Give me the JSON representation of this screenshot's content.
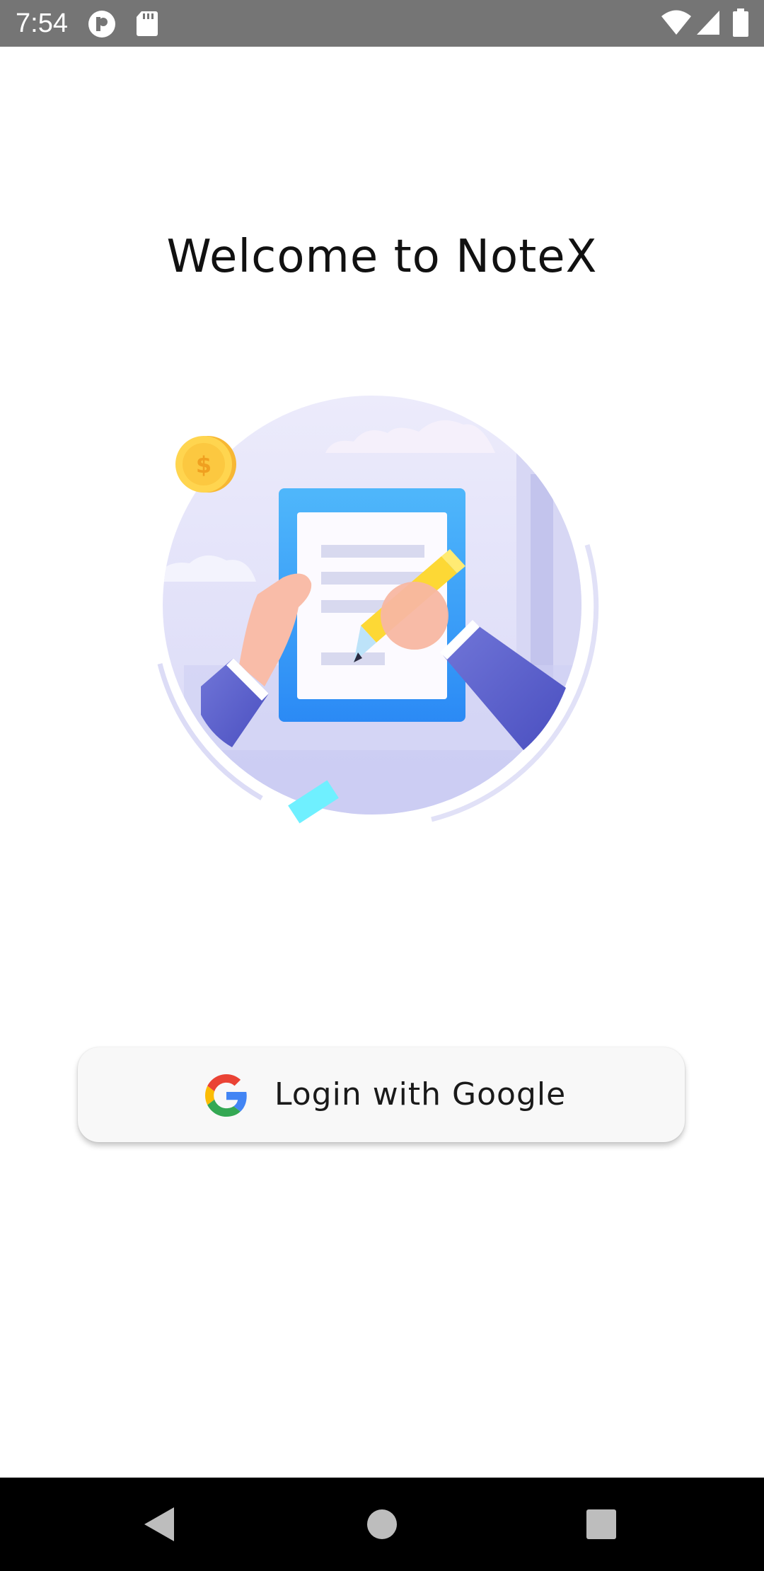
{
  "status_bar": {
    "time": "7:54",
    "background_color": "#757575",
    "icons": [
      "notification-app-icon",
      "sd-card-icon",
      "wifi-icon",
      "signal-icon",
      "battery-icon"
    ]
  },
  "welcome": {
    "title": "Welcome to NoteX"
  },
  "illustration": {
    "description_icon": "note-writing-illustration",
    "coin_symbol": "$"
  },
  "login_button": {
    "label": "Login with Google",
    "icon": "google-icon"
  },
  "nav_bar": {
    "back": "back-icon",
    "home": "home-icon",
    "recents": "recents-icon"
  },
  "colors": {
    "accent_blue": "#3399ff",
    "illustration_purple": "#5b5fc7",
    "pencil_yellow": "#fdd835"
  }
}
